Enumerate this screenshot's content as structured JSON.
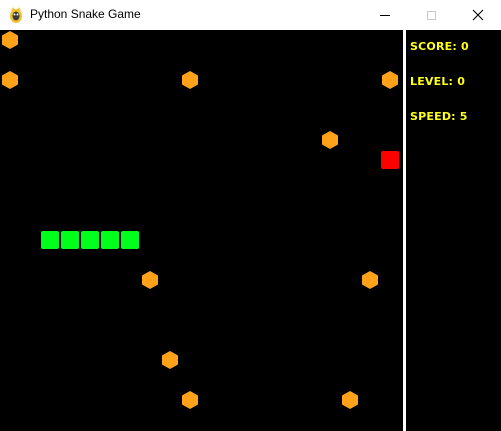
{
  "window": {
    "title": "Python Snake Game"
  },
  "hud": {
    "score_label": "SCORE: 0",
    "level_label": "LEVEL: 0",
    "speed_label": "SPEED: 5",
    "score": 0,
    "level": 0,
    "speed": 5
  },
  "colors": {
    "background": "#000000",
    "snake": "#00ff1a",
    "food": "#ff0000",
    "obstacle": "#ffa21a",
    "hud_text": "#ffff1a",
    "divider": "#ffffff"
  },
  "icons": [
    "pygame-snake-icon",
    "minimize-icon",
    "maximize-icon",
    "close-icon",
    "hexagon-obstacle-icon"
  ],
  "game": {
    "cell_size": 20,
    "snake": [
      [
        2,
        10
      ],
      [
        3,
        10
      ],
      [
        4,
        10
      ],
      [
        5,
        10
      ],
      [
        6,
        10
      ]
    ],
    "food": [
      19,
      6
    ],
    "obstacles": [
      [
        0,
        0
      ],
      [
        0,
        2
      ],
      [
        9,
        2
      ],
      [
        19,
        2
      ],
      [
        16,
        5
      ],
      [
        7,
        12
      ],
      [
        18,
        12
      ],
      [
        8,
        16
      ],
      [
        9,
        18
      ],
      [
        17,
        18
      ]
    ]
  }
}
